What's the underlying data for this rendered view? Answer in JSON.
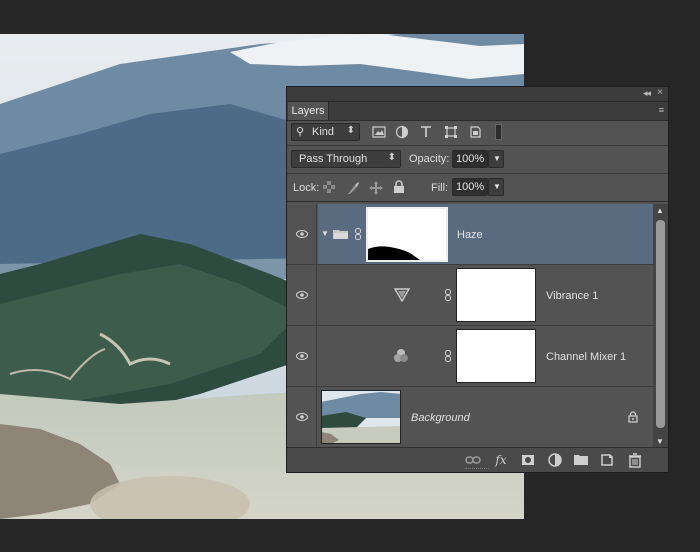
{
  "panel": {
    "collapse_glyph": "◂◂",
    "close_glyph": "×",
    "tab_label": "Layers",
    "menu_glyph": "≡"
  },
  "filter": {
    "kind_label": "Kind",
    "search_glyph": "⚲",
    "arrows": "⬍",
    "icons": [
      "image-filter-icon",
      "adjustment-filter-icon",
      "type-filter-icon",
      "shape-filter-icon",
      "smart-object-filter-icon",
      "filter-toggle-icon"
    ]
  },
  "blend": {
    "mode": "Pass Through",
    "opacity_label": "Opacity:",
    "opacity_value": "100%",
    "lock_label": "Lock:",
    "fill_label": "Fill:",
    "fill_value": "100%"
  },
  "layers": [
    {
      "name": "Haze",
      "type": "group",
      "selected": true
    },
    {
      "name": "Vibrance 1",
      "type": "adjustment",
      "selected": false
    },
    {
      "name": "Channel Mixer 1",
      "type": "adjustment",
      "selected": false
    },
    {
      "name": "Background",
      "type": "image",
      "selected": false
    }
  ],
  "footer": {
    "icons": [
      "link-layers-icon",
      "fx-icon",
      "add-mask-icon",
      "new-adjustment-icon",
      "new-group-icon",
      "new-layer-icon",
      "trash-icon"
    ],
    "fx_label": "fx"
  },
  "colors": {
    "panel_bg": "#535353",
    "selected_row": "#5a6b80",
    "workspace_bg": "#262626"
  }
}
